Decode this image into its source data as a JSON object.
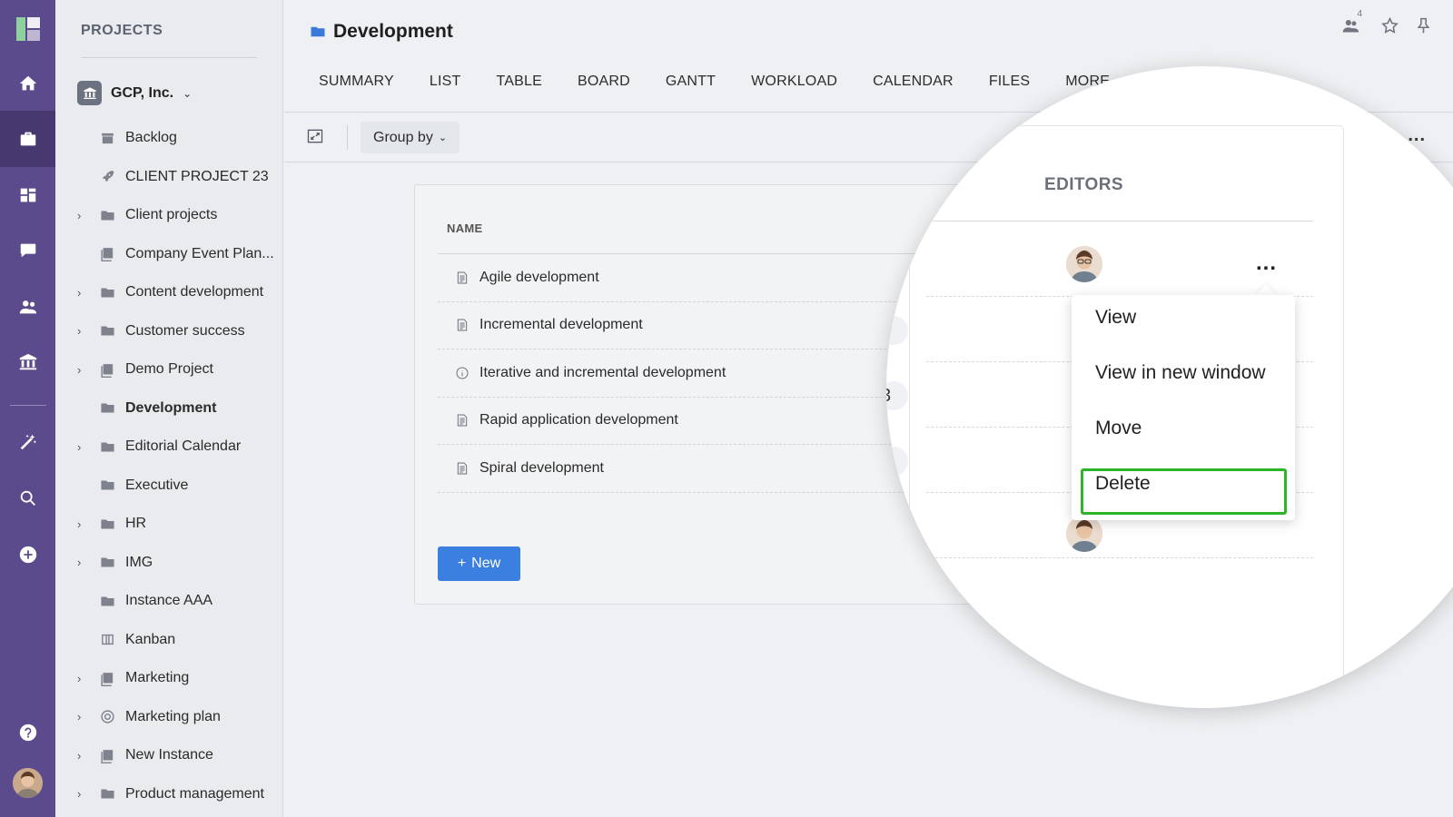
{
  "rail": {
    "items": [
      {
        "name": "home-icon"
      },
      {
        "name": "briefcase-icon"
      },
      {
        "name": "dashboard-icon"
      },
      {
        "name": "chat-icon"
      },
      {
        "name": "people-icon"
      },
      {
        "name": "institution-icon"
      },
      {
        "name": "magic-wand-icon"
      },
      {
        "name": "search-icon"
      },
      {
        "name": "plus-circle-icon"
      },
      {
        "name": "help-icon"
      }
    ],
    "accent": "#5c4b8c"
  },
  "sidebar": {
    "heading": "PROJECTS",
    "org": {
      "label": "GCP, Inc.",
      "icon": "institution-icon"
    },
    "items": [
      {
        "label": "Backlog",
        "icon": "archive-icon",
        "expandable": false
      },
      {
        "label": "CLIENT PROJECT 23",
        "icon": "rocket-icon",
        "expandable": false
      },
      {
        "label": "Client projects",
        "icon": "folder-icon",
        "expandable": true
      },
      {
        "label": "Company Event Plan...",
        "icon": "project-icon",
        "expandable": false
      },
      {
        "label": "Content development",
        "icon": "folder-icon",
        "expandable": true
      },
      {
        "label": "Customer success",
        "icon": "folder-icon",
        "expandable": true
      },
      {
        "label": "Demo Project",
        "icon": "project-icon",
        "expandable": true
      },
      {
        "label": "Development",
        "icon": "folder-icon",
        "expandable": false,
        "current": true
      },
      {
        "label": "Editorial Calendar",
        "icon": "folder-icon",
        "expandable": true
      },
      {
        "label": "Executive",
        "icon": "folder-icon",
        "expandable": false
      },
      {
        "label": "HR",
        "icon": "folder-icon",
        "expandable": true
      },
      {
        "label": "IMG",
        "icon": "folder-icon",
        "expandable": true
      },
      {
        "label": "Instance AAA",
        "icon": "folder-icon",
        "expandable": false
      },
      {
        "label": "Kanban",
        "icon": "board-icon",
        "expandable": false
      },
      {
        "label": "Marketing",
        "icon": "project-icon",
        "expandable": true
      },
      {
        "label": "Marketing plan",
        "icon": "target-icon",
        "expandable": true
      },
      {
        "label": "New Instance",
        "icon": "project-icon",
        "expandable": true
      },
      {
        "label": "Product management",
        "icon": "folder-icon",
        "expandable": true
      }
    ]
  },
  "header": {
    "title": "Development",
    "members_count": "4",
    "tabs": [
      "SUMMARY",
      "LIST",
      "TABLE",
      "BOARD",
      "GANTT",
      "WORKLOAD",
      "CALENDAR",
      "FILES",
      "MORE"
    ]
  },
  "toolbar": {
    "group_by_label": "Group by",
    "more_label": "..."
  },
  "table": {
    "column_name": "NAME",
    "rows": [
      {
        "label": "Agile development",
        "icon": "document-icon"
      },
      {
        "label": "Incremental development",
        "icon": "document-icon"
      },
      {
        "label": "Iterative and incremental development",
        "icon": "info-icon"
      },
      {
        "label": "Rapid application development",
        "icon": "document-icon"
      },
      {
        "label": "Spiral development",
        "icon": "document-icon"
      }
    ],
    "new_button": "New"
  },
  "magnifier": {
    "editors_heading": "EDITORS",
    "row_menu_label": "...",
    "partial_cell_text": "3",
    "menu": {
      "items": [
        "View",
        "View in new window",
        "Move",
        "Delete"
      ],
      "highlighted": "Delete",
      "highlight_color": "#2db52a"
    }
  }
}
